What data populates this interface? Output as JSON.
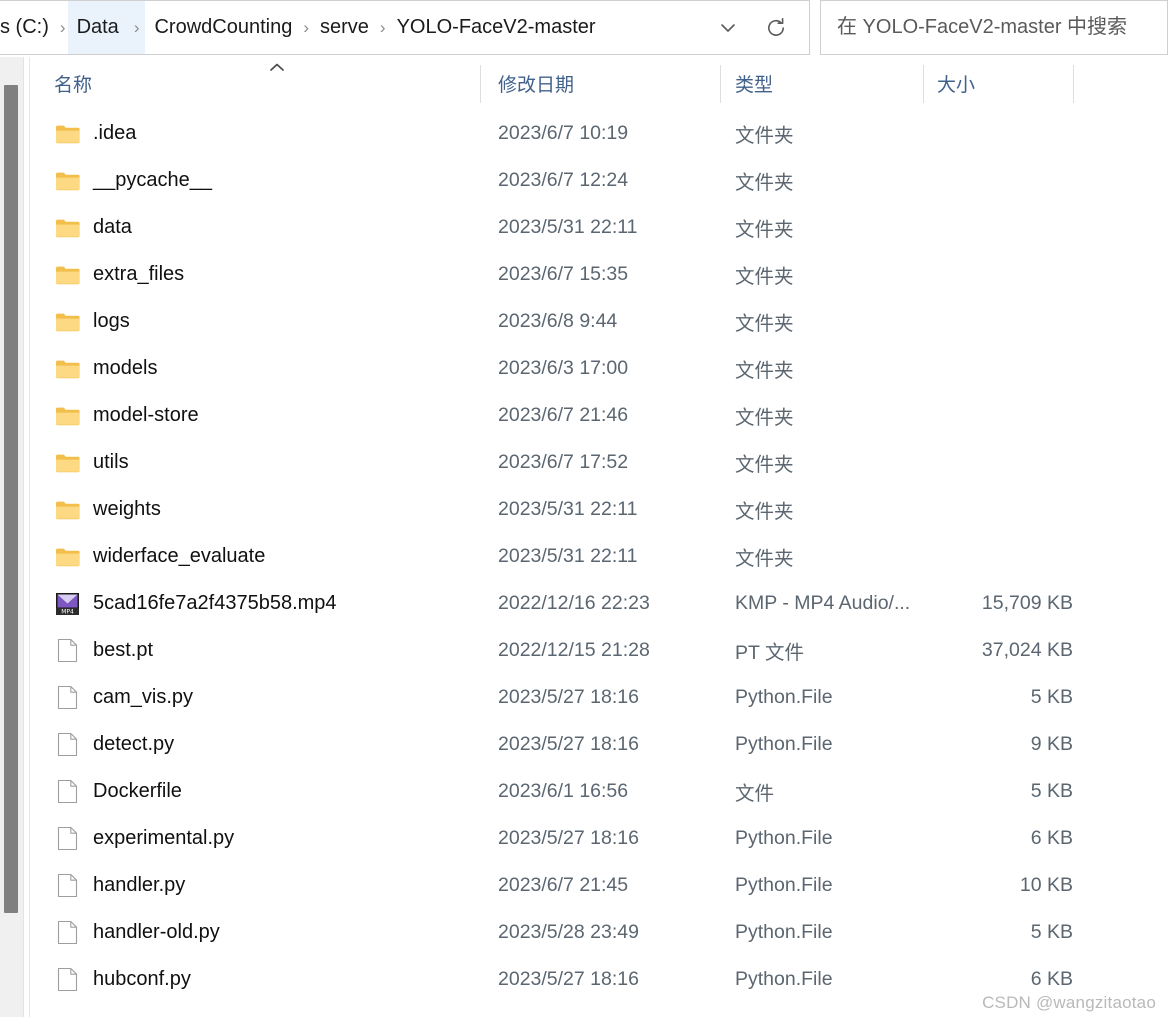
{
  "window": {
    "app": "File Explorer",
    "locale": "zh-CN"
  },
  "addressbar": {
    "crumbs": [
      {
        "label": "s (C:)",
        "highlight": false,
        "truncated": true
      },
      {
        "label": "Data",
        "highlight": true
      },
      {
        "label": "CrowdCounting",
        "highlight": false
      },
      {
        "label": "serve",
        "highlight": false
      },
      {
        "label": "YOLO-FaceV2-master",
        "highlight": false
      }
    ],
    "separator": "›",
    "dropdown_icon": "chevron-down-icon",
    "refresh_icon": "refresh-icon"
  },
  "search": {
    "placeholder": "在 YOLO-FaceV2-master 中搜索",
    "value": ""
  },
  "columns": {
    "name": "名称",
    "date_modified": "修改日期",
    "type": "类型",
    "size": "大小",
    "sort_column": "名称",
    "sort_direction": "ascending"
  },
  "types": {
    "folder": "文件夹",
    "file": "文件",
    "python": "Python.File",
    "pt": "PT 文件",
    "mp4": "KMP - MP4 Audio/..."
  },
  "files": [
    {
      "name": ".idea",
      "date": "2023/6/7 10:19",
      "type": "文件夹",
      "size": "",
      "icon": "folder-icon"
    },
    {
      "name": "__pycache__",
      "date": "2023/6/7 12:24",
      "type": "文件夹",
      "size": "",
      "icon": "folder-icon"
    },
    {
      "name": "data",
      "date": "2023/5/31 22:11",
      "type": "文件夹",
      "size": "",
      "icon": "folder-icon"
    },
    {
      "name": "extra_files",
      "date": "2023/6/7 15:35",
      "type": "文件夹",
      "size": "",
      "icon": "folder-icon"
    },
    {
      "name": "logs",
      "date": "2023/6/8 9:44",
      "type": "文件夹",
      "size": "",
      "icon": "folder-icon"
    },
    {
      "name": "models",
      "date": "2023/6/3 17:00",
      "type": "文件夹",
      "size": "",
      "icon": "folder-icon"
    },
    {
      "name": "model-store",
      "date": "2023/6/7 21:46",
      "type": "文件夹",
      "size": "",
      "icon": "folder-icon"
    },
    {
      "name": "utils",
      "date": "2023/6/7 17:52",
      "type": "文件夹",
      "size": "",
      "icon": "folder-icon"
    },
    {
      "name": "weights",
      "date": "2023/5/31 22:11",
      "type": "文件夹",
      "size": "",
      "icon": "folder-icon"
    },
    {
      "name": "widerface_evaluate",
      "date": "2023/5/31 22:11",
      "type": "文件夹",
      "size": "",
      "icon": "folder-icon"
    },
    {
      "name": "5cad16fe7a2f4375b58.mp4",
      "date": "2022/12/16 22:23",
      "type": "KMP - MP4 Audio/...",
      "size": "15,709 KB",
      "icon": "mp4-file-icon"
    },
    {
      "name": "best.pt",
      "date": "2022/12/15 21:28",
      "type": "PT 文件",
      "size": "37,024 KB",
      "icon": "generic-file-icon"
    },
    {
      "name": "cam_vis.py",
      "date": "2023/5/27 18:16",
      "type": "Python.File",
      "size": "5 KB",
      "icon": "generic-file-icon"
    },
    {
      "name": "detect.py",
      "date": "2023/5/27 18:16",
      "type": "Python.File",
      "size": "9 KB",
      "icon": "generic-file-icon"
    },
    {
      "name": "Dockerfile",
      "date": "2023/6/1 16:56",
      "type": "文件",
      "size": "5 KB",
      "icon": "generic-file-icon"
    },
    {
      "name": "experimental.py",
      "date": "2023/5/27 18:16",
      "type": "Python.File",
      "size": "6 KB",
      "icon": "generic-file-icon"
    },
    {
      "name": "handler.py",
      "date": "2023/6/7 21:45",
      "type": "Python.File",
      "size": "10 KB",
      "icon": "generic-file-icon"
    },
    {
      "name": "handler-old.py",
      "date": "2023/5/28 23:49",
      "type": "Python.File",
      "size": "5 KB",
      "icon": "generic-file-icon"
    },
    {
      "name": "hubconf.py",
      "date": "2023/5/27 18:16",
      "type": "Python.File",
      "size": "6 KB",
      "icon": "generic-file-icon"
    }
  ],
  "watermark": {
    "text": "CSDN @wangzitaotao"
  },
  "colors": {
    "folder": "#f6c256",
    "folder_light": "#fcdf9a",
    "header_text": "#41618c",
    "secondary_text": "#5b6670",
    "crumb_highlight": "#eaf3fc",
    "scrollbar_thumb": "#808080"
  }
}
